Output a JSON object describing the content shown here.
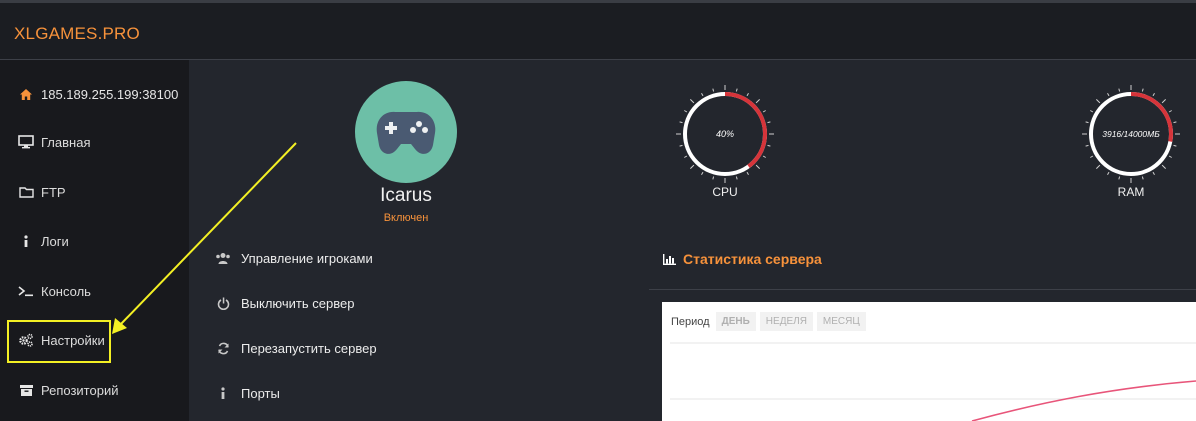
{
  "brand": "XLGAMES.PRO",
  "sidebar": {
    "items": [
      {
        "label": "185.189.255.199:38100",
        "icon": "home-icon"
      },
      {
        "label": "Главная",
        "icon": "monitor-icon"
      },
      {
        "label": "FTP",
        "icon": "folder-icon"
      },
      {
        "label": "Логи",
        "icon": "info-icon"
      },
      {
        "label": "Консоль",
        "icon": "terminal-icon"
      },
      {
        "label": "Настройки",
        "icon": "gears-icon"
      },
      {
        "label": "Репозиторий",
        "icon": "archive-icon"
      }
    ]
  },
  "server": {
    "name": "Icarus",
    "status": "Включен",
    "avatar_icon": "gamepad-icon"
  },
  "actions": [
    {
      "label": "Управление игроками",
      "icon": "users-icon"
    },
    {
      "label": "Выключить сервер",
      "icon": "power-icon"
    },
    {
      "label": "Перезапустить сервер",
      "icon": "refresh-icon"
    },
    {
      "label": "Порты",
      "icon": "info-icon"
    }
  ],
  "gauges": {
    "cpu": {
      "label": "CPU",
      "value_text": "40%",
      "fraction": 0.4
    },
    "ram": {
      "label": "RAM",
      "value_text": "3916/14000МБ",
      "fraction": 0.28
    }
  },
  "stats": {
    "title": "Статистика сервера",
    "period_label": "Период",
    "periods": [
      "ДЕНЬ",
      "НЕДЕЛЯ",
      "МЕСЯЦ"
    ]
  },
  "colors": {
    "accent": "#f7923b",
    "gauge_fill": "#d6343a",
    "highlight": "#f3f024",
    "chart_line": "#e8557a"
  }
}
